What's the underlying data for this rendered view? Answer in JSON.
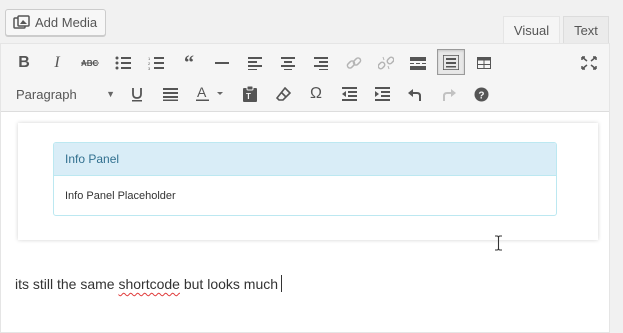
{
  "media": {
    "add_media_label": "Add Media",
    "icon": "add-media-icon"
  },
  "tabs": [
    {
      "label": "Visual",
      "active": true
    },
    {
      "label": "Text",
      "active": false
    }
  ],
  "toolbar": {
    "row1": [
      {
        "name": "bold",
        "icon": "bold-icon"
      },
      {
        "name": "italic",
        "icon": "italic-icon"
      },
      {
        "name": "strikethrough",
        "icon": "strikethrough-icon"
      },
      {
        "name": "bulleted-list",
        "icon": "bulleted-list-icon"
      },
      {
        "name": "numbered-list",
        "icon": "numbered-list-icon"
      },
      {
        "name": "blockquote",
        "icon": "blockquote-icon"
      },
      {
        "name": "horizontal-line",
        "icon": "horizontal-line-icon"
      },
      {
        "name": "align-left",
        "icon": "align-left-icon"
      },
      {
        "name": "align-center",
        "icon": "align-center-icon"
      },
      {
        "name": "align-right",
        "icon": "align-right-icon"
      },
      {
        "name": "insert-link",
        "icon": "link-icon"
      },
      {
        "name": "remove-link",
        "icon": "unlink-icon"
      },
      {
        "name": "read-more",
        "icon": "read-more-icon"
      },
      {
        "name": "toolbar-toggle",
        "icon": "kitchen-sink-icon",
        "active": true
      },
      {
        "name": "table",
        "icon": "table-icon"
      },
      {
        "name": "distraction-free",
        "icon": "fullscreen-icon"
      }
    ],
    "format_select": {
      "value": "Paragraph"
    },
    "row2": [
      {
        "name": "underline",
        "icon": "underline-icon"
      },
      {
        "name": "justify",
        "icon": "justify-icon"
      },
      {
        "name": "text-color",
        "icon": "text-color-icon"
      },
      {
        "name": "paste-as-text",
        "icon": "paste-text-icon"
      },
      {
        "name": "clear-formatting",
        "icon": "eraser-icon"
      },
      {
        "name": "special-character",
        "icon": "omega-icon"
      },
      {
        "name": "decrease-indent",
        "icon": "outdent-icon"
      },
      {
        "name": "increase-indent",
        "icon": "indent-icon"
      },
      {
        "name": "undo",
        "icon": "undo-icon"
      },
      {
        "name": "redo",
        "icon": "redo-icon",
        "disabled": true
      },
      {
        "name": "help",
        "icon": "help-icon"
      }
    ]
  },
  "content": {
    "panel": {
      "heading": "Info Panel",
      "body": "Info Panel Placeholder"
    },
    "paragraph": {
      "before": "its still the same ",
      "misspelled": "shortcode",
      "after": " but looks much"
    }
  },
  "colors": {
    "panel_heading_bg": "#d9edf7",
    "panel_border": "#bce8f1",
    "panel_heading_text": "#31708f",
    "spellcheck_underline": "#e03a3a"
  }
}
